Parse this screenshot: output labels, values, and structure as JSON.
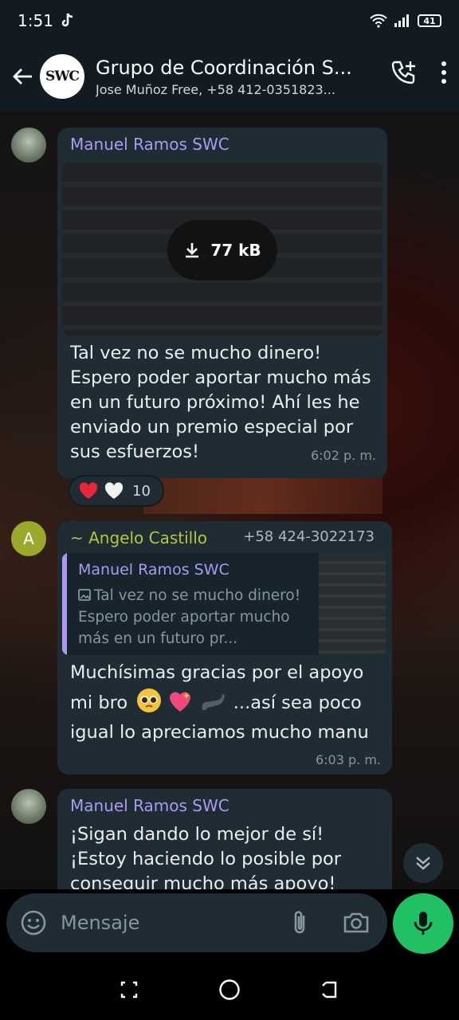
{
  "status_bar": {
    "time": "1:51",
    "battery": "41"
  },
  "header": {
    "group_avatar_text": "SWC",
    "title": "Grupo de Coordinación S...",
    "subtitle": "Jose Muñoz Free, +58 412-0351823..."
  },
  "messages": [
    {
      "sender": "Manuel Ramos SWC",
      "attachment_size": "77 kB",
      "text": "Tal vez no se mucho dinero! Espero poder aportar mucho más en un futuro próximo! Ahí les he enviado un premio especial por sus esfuerzos!",
      "time": "6:02 p. m.",
      "reaction_count": "10"
    },
    {
      "avatar_letter": "A",
      "sender": "~ Angelo Castillo",
      "phone": "+58 424-3022173",
      "quote_sender": "Manuel Ramos SWC",
      "quote_text": "Tal vez no se mucho dinero! Espero poder aportar mucho más en un futuro pr...",
      "text_line1": "Muchísimas gracias por el apoyo",
      "text_line2_a": "mi bro",
      "text_line2_b": "...así sea poco",
      "text_line3": "igual lo  apreciamos mucho manu",
      "time": "6:03 p. m."
    },
    {
      "sender": "Manuel Ramos SWC",
      "text": "¡Sigan dando lo mejor de sí! ¡Estoy haciendo lo posible por conseguir mucho más apoyo!"
    }
  ],
  "composer": {
    "placeholder": "Mensaje"
  },
  "colors": {
    "accent_green": "#21c063",
    "bubble": "#1f2c34",
    "sender_purple": "#a99cf0",
    "sender_green": "#b5c63c"
  }
}
